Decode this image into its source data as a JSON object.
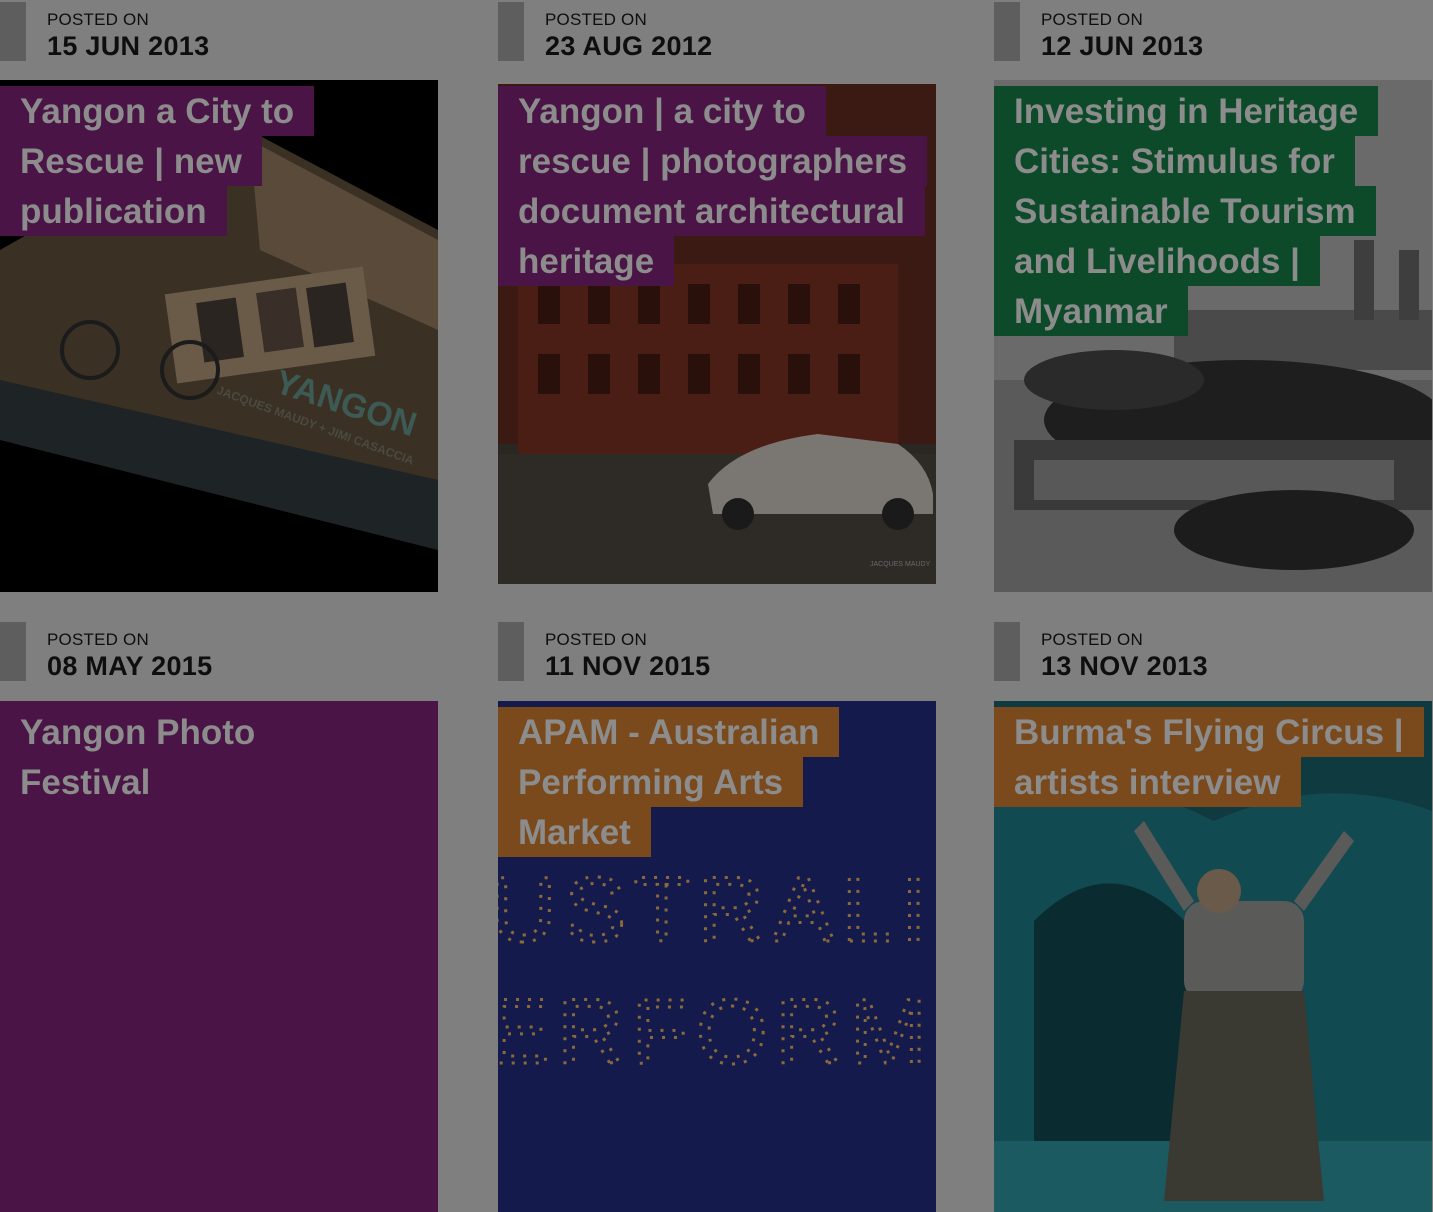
{
  "posts": [
    {
      "posted_label": "POSTED ON",
      "date": "15 JUN 2013",
      "title_lines": [
        "Yangon a City to",
        "Rescue | new",
        "publication"
      ]
    },
    {
      "posted_label": "POSTED ON",
      "date": "23 AUG 2012",
      "title_lines": [
        "Yangon | a city to",
        "rescue | photographers",
        "document architectural",
        "heritage"
      ]
    },
    {
      "posted_label": "POSTED ON",
      "date": "12 JUN 2013",
      "title_lines": [
        "Investing in Heritage",
        "Cities: Stimulus for",
        "Sustainable Tourism",
        "and Livelihoods |",
        "Myanmar"
      ]
    },
    {
      "posted_label": "POSTED ON",
      "date": "08 MAY 2015",
      "title_lines": [
        "Yangon Photo",
        "Festival"
      ]
    },
    {
      "posted_label": "POSTED ON",
      "date": "11 NOV 2015",
      "title_lines": [
        "APAM - Australian",
        "Performing Arts",
        "Market"
      ]
    },
    {
      "posted_label": "POSTED ON",
      "date": "13 NOV 2013",
      "title_lines": [
        "Burma's Flying Circus |",
        "artists interview"
      ]
    }
  ],
  "image_text": {
    "book_cover_title": "YANGON",
    "book_cover_authors": "JACQUES MAUDY + JIMI CASACCIA",
    "photo_credit": "JACQUES MAUDY",
    "poster_line_1": "USTRALI",
    "poster_line_2": "ERFORM"
  },
  "colors": {
    "page_bg": "#7f7f7f",
    "dim_overlay": "rgba(0,0,0,0.5)",
    "purple": "#4a1446",
    "green": "#0c4a2a",
    "orange": "#7a4a1c",
    "navy": "#141a4c"
  }
}
